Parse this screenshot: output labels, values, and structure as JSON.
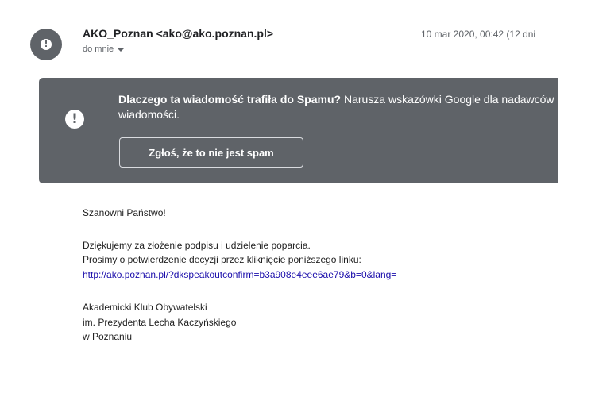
{
  "header": {
    "sender": "AKO_Poznan <ako@ako.poznan.pl>",
    "recipient": "do mnie",
    "timestamp": "10 mar 2020, 00:42 (12 dni"
  },
  "icons": {
    "avatar": "exclamation-icon",
    "banner": "exclamation-icon",
    "recipient_dropdown": "caret-down-icon"
  },
  "spam_banner": {
    "heading": "Dlaczego ta wiadomość trafiła do Spamu?",
    "explanation": " Narusza wskazówki Google dla nadawców wiadomości.",
    "report_button": "Zgłoś, że to nie jest spam"
  },
  "body": {
    "greeting": "Szanowni Państwo!",
    "thanks": "Dziękujemy za złożenie podpisu i udzielenie poparcia.",
    "instruction": "Prosimy o potwierdzenie decyzji przez kliknięcie poniższego linku:",
    "confirm_link": "http://ako.poznan.pl/?dkspeakoutconfirm=b3a908e4eee6ae79&b=0&lang=",
    "signature": [
      "Akademicki Klub Obywatelski",
      "im. Prezydenta Lecha Kaczyńskiego",
      "w Poznaniu"
    ]
  },
  "colors": {
    "banner_background": "#5f6368",
    "link": "#1a0dab",
    "avatar_background": "#5f6368"
  }
}
